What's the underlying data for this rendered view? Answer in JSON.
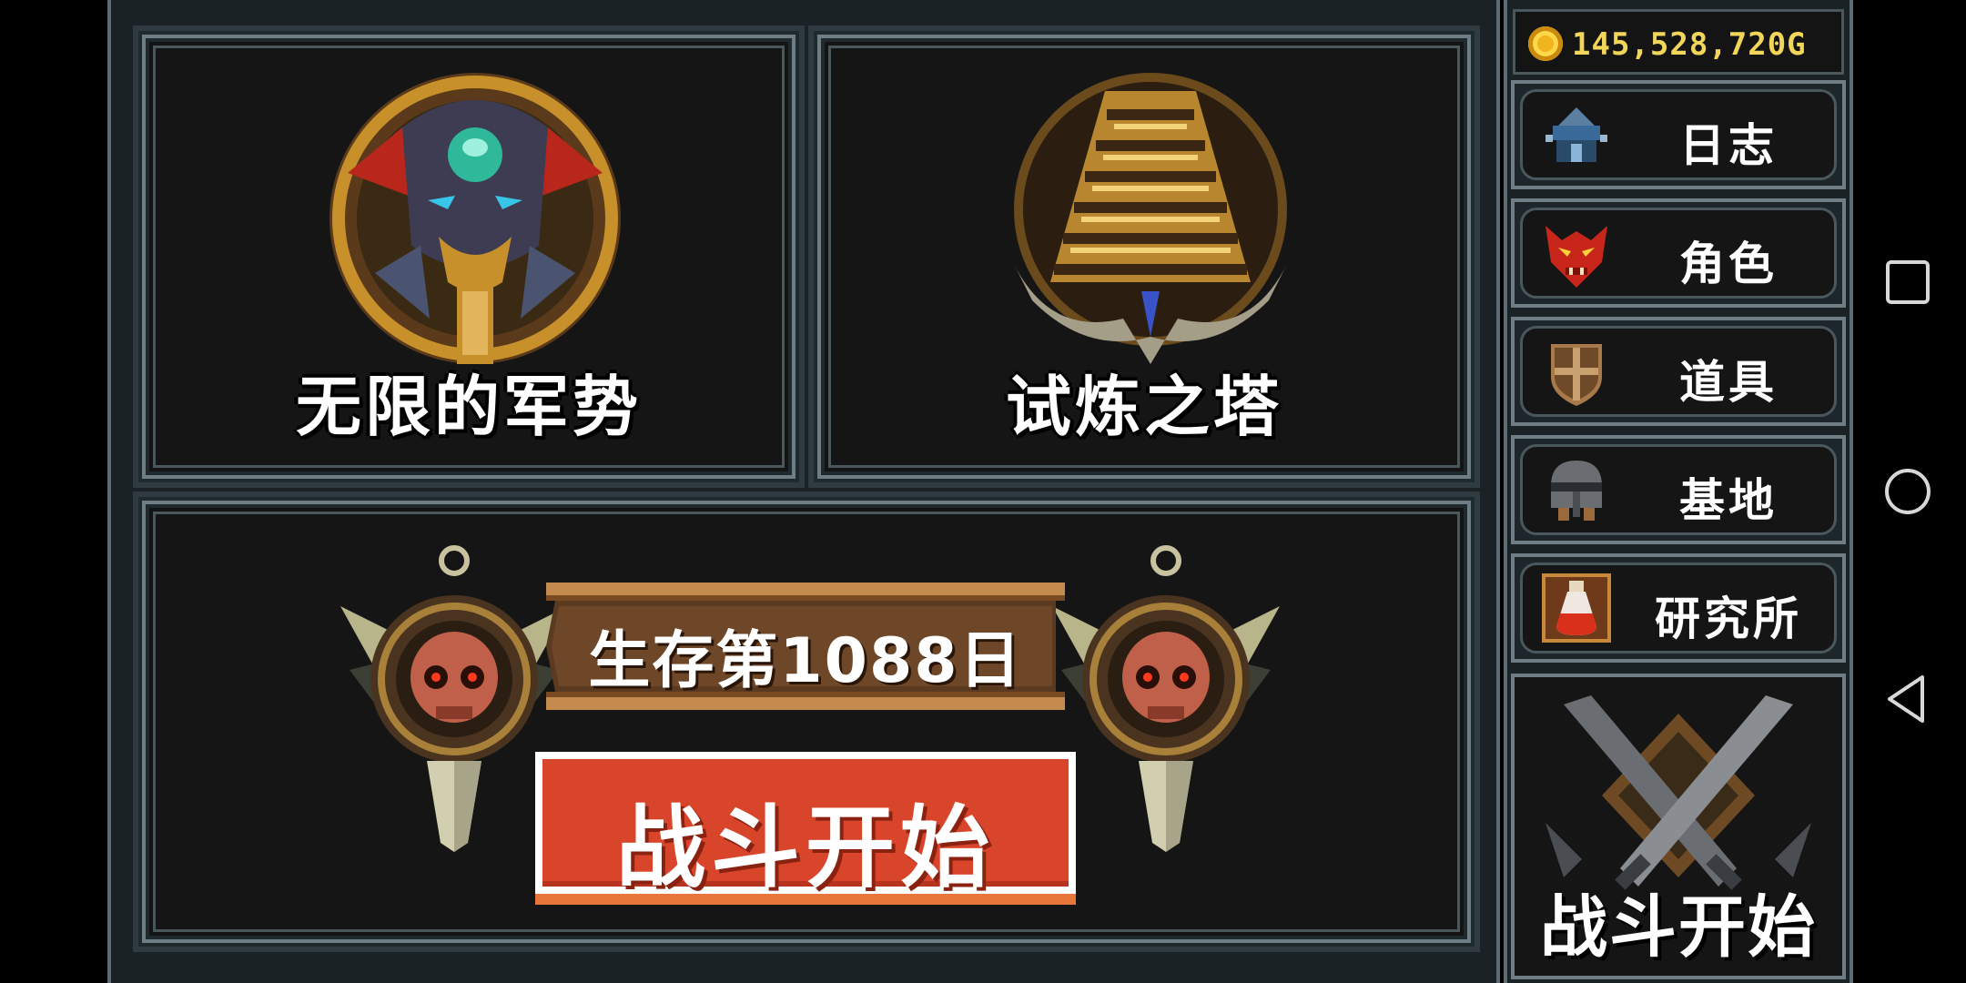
{
  "modes": {
    "legion": {
      "title": "无限的军势",
      "emblem": "demon-mask-emblem-icon"
    },
    "tower": {
      "title": "试炼之塔",
      "emblem": "tower-emblem-icon"
    }
  },
  "survival": {
    "banner_text": "生存第1088日",
    "start_label": "战斗开始"
  },
  "sidebar": {
    "gold": "145,528,720G",
    "coin_icon": "gold-coin-icon",
    "items": [
      {
        "label": "日志",
        "icon": "journal-icon"
      },
      {
        "label": "角色",
        "icon": "character-mask-icon"
      },
      {
        "label": "道具",
        "icon": "shield-icon"
      },
      {
        "label": "基地",
        "icon": "helmet-icon"
      },
      {
        "label": "研究所",
        "icon": "potion-icon"
      }
    ],
    "battle_label": "战斗开始",
    "battle_icon": "crossed-swords-icon"
  },
  "navbar": {
    "buttons": [
      "recent-apps-icon",
      "home-icon",
      "back-icon"
    ]
  },
  "colors": {
    "frame": "#5d6b72",
    "panel_bg": "#141414",
    "gold_text": "#f2d65a",
    "start_button": "#d9452b"
  }
}
